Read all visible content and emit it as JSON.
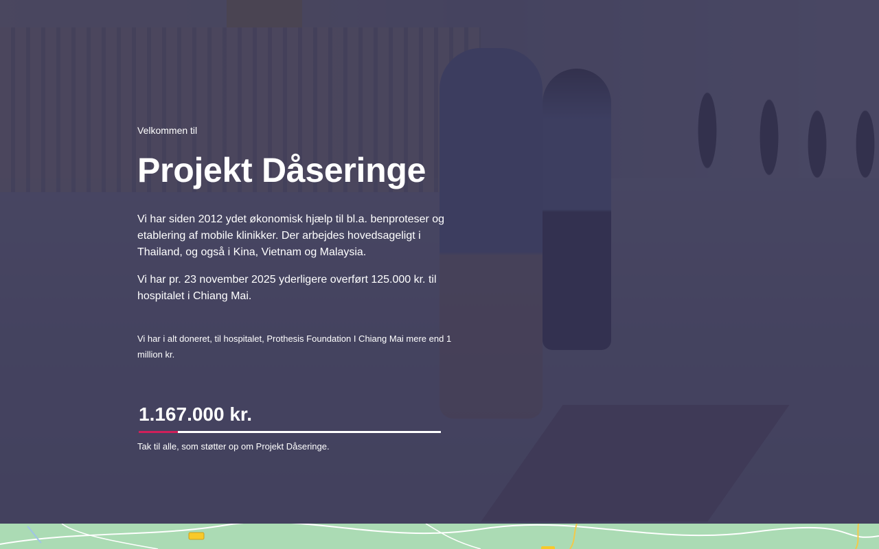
{
  "hero": {
    "welcome": "Velkommen til",
    "title": "Projekt Dåseringe",
    "paragraph_1": "Vi har siden 2012 ydet økonomisk hjælp til bl.a. benproteser og etablering af mobile klinikker. Der arbejdes hovedsageligt i Thailand, og også i Kina, Vietnam og Malaysia.",
    "paragraph_2": "Vi har pr. 23 november 2025 yderligere overført 125.000 kr. til hospitalet i Chiang Mai.",
    "small_text": "Vi har i alt doneret, til hospitalet, Prothesis Foundation I Chiang Mai  mere end 1 million kr."
  },
  "counter": {
    "amount": "1.167.000 kr.",
    "progress_fraction": 0.13,
    "thanks": "Tak til alle, som støtter op om Projekt Dåseringe."
  },
  "colors": {
    "overlay": "#343252",
    "accent": "#d11f5a",
    "text": "#ffffff",
    "map_land": "#abdbb4"
  }
}
